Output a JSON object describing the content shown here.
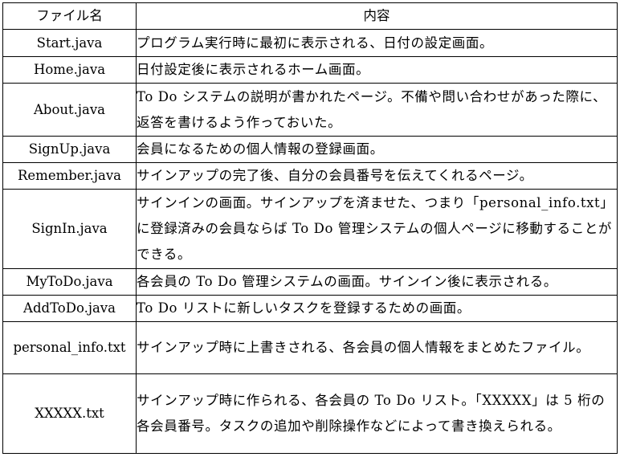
{
  "table": {
    "headers": {
      "name": "ファイル名",
      "content": "内容"
    },
    "rows": [
      {
        "name": "Start.java",
        "content": "プログラム実行時に最初に表示される、日付の設定画面。"
      },
      {
        "name": "Home.java",
        "content": "日付設定後に表示されるホーム画面。"
      },
      {
        "name": "About.java",
        "content": "To Do システムの説明が書かれたページ。不備や問い合わせがあった際に、返答を書けるよう作っておいた。"
      },
      {
        "name": "SignUp.java",
        "content": "会員になるための個人情報の登録画面。"
      },
      {
        "name": "Remember.java",
        "content": "サインアップの完了後、自分の会員番号を伝えてくれるページ。"
      },
      {
        "name": "SignIn.java",
        "content": "サインインの画面。サインアップを済ませた、つまり「personal_info.txt」に登録済みの会員ならば To Do 管理システムの個人ページに移動することができる。"
      },
      {
        "name": "MyToDo.java",
        "content": "各会員の To Do 管理システムの画面。サインイン後に表示される。"
      },
      {
        "name": "AddToDo.java",
        "content": "To Do リストに新しいタスクを登録するための画面。"
      },
      {
        "name": "personal_info.txt",
        "content": "サインアップ時に上書きされる、各会員の個人情報をまとめたファイル。"
      },
      {
        "name": "XXXXX.txt",
        "content": "サインアップ時に作られる、各会員の To Do リスト。「XXXXX」は 5 桁の各会員番号。タスクの追加や削除操作などによって書き換えられる。"
      }
    ]
  }
}
